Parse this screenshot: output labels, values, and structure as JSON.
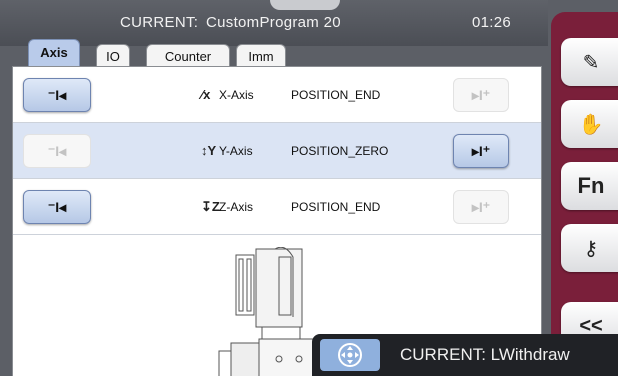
{
  "header": {
    "current_prefix": "CURRENT:",
    "program_name": "CustomProgram 20",
    "time": "01:26"
  },
  "tabs": [
    {
      "label": "Axis",
      "active": true
    },
    {
      "label": "IO",
      "active": false
    },
    {
      "label": "Counter",
      "active": false
    },
    {
      "label": "Imm",
      "active": false
    }
  ],
  "axes": [
    {
      "icon": "x-axis-icon",
      "icon_glyph": "⁄x",
      "name": "X-Axis",
      "status": "POSITION_END",
      "left_button": "on",
      "right_button": "off",
      "selected": false
    },
    {
      "icon": "y-axis-icon",
      "icon_glyph": "↕Y",
      "name": "Y-Axis",
      "status": "POSITION_ZERO",
      "left_button": "off",
      "right_button": "on",
      "selected": true
    },
    {
      "icon": "z-axis-icon",
      "icon_glyph": "↧Z",
      "name": "Z-Axis",
      "status": "POSITION_END",
      "left_button": "on",
      "right_button": "off",
      "selected": false
    }
  ],
  "sidebar": [
    {
      "name": "edit-pencil-icon",
      "glyph": "✎"
    },
    {
      "name": "hand-manual-icon",
      "glyph": "✋"
    },
    {
      "name": "function-fn-icon",
      "glyph": "Fn"
    },
    {
      "name": "key-icon",
      "glyph": "⚷"
    },
    {
      "name": "collapse-chevrons-icon",
      "glyph": "<<"
    }
  ],
  "status": {
    "text": "CURRENT: LWithdraw"
  },
  "colors": {
    "accent": "#7a1f3a",
    "tab_active": "#b9cbea",
    "row_selected": "#dbe4f4",
    "button_active": "#b6c8e6"
  }
}
